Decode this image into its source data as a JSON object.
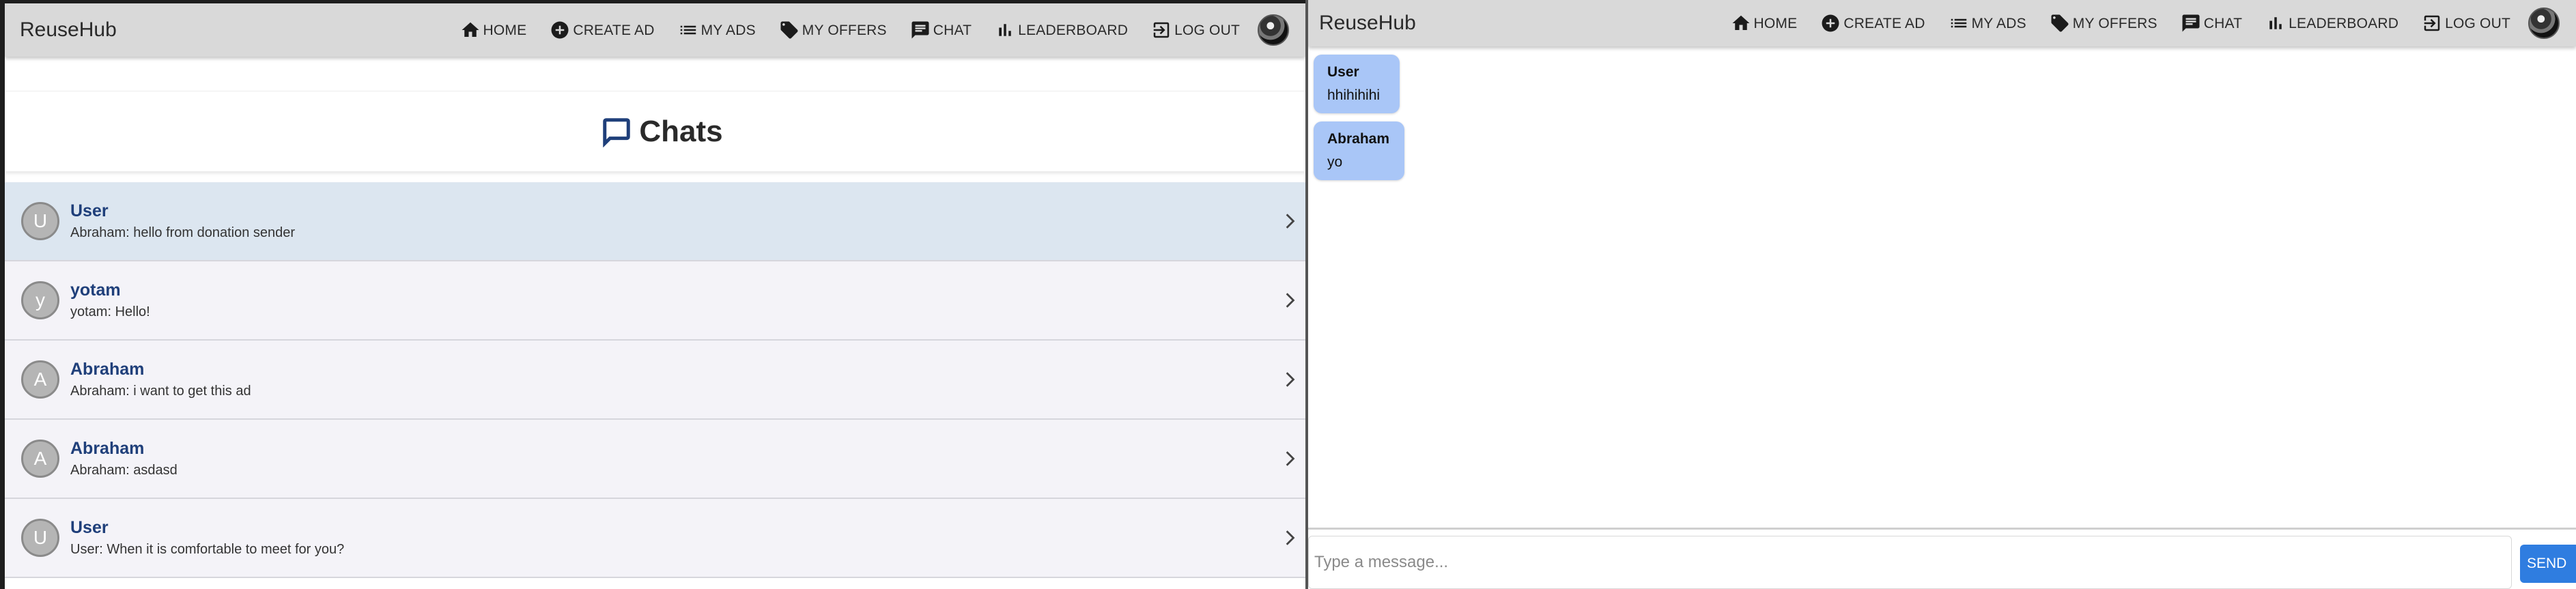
{
  "brand": "ReuseHub",
  "nav": [
    {
      "label": "HOME",
      "icon": "home-icon"
    },
    {
      "label": "CREATE AD",
      "icon": "plus-circle-icon"
    },
    {
      "label": "MY ADS",
      "icon": "list-icon"
    },
    {
      "label": "MY OFFERS",
      "icon": "tag-icon"
    },
    {
      "label": "CHAT",
      "icon": "chat-icon"
    },
    {
      "label": "LEADERBOARD",
      "icon": "bar-chart-icon"
    },
    {
      "label": "LOG OUT",
      "icon": "logout-icon"
    }
  ],
  "chats_page": {
    "title": "Chats",
    "items": [
      {
        "initial": "U",
        "name": "User",
        "preview": "Abraham: hello from donation sender",
        "active": true
      },
      {
        "initial": "y",
        "name": "yotam",
        "preview": "yotam: Hello!"
      },
      {
        "initial": "A",
        "name": "Abraham",
        "preview": "Abraham: i want to get this ad"
      },
      {
        "initial": "A",
        "name": "Abraham",
        "preview": "Abraham: asdasd"
      },
      {
        "initial": "U",
        "name": "User",
        "preview": "User: When it is comfortable to meet for you?"
      }
    ]
  },
  "chat_room": {
    "messages": [
      {
        "sender": "User",
        "text": "hhihihihi"
      },
      {
        "sender": "Abraham",
        "text": "yo"
      }
    ],
    "input_placeholder": "Type a message...",
    "send_label": "SEND"
  },
  "colors": {
    "navbar_bg": "#d9d9d9",
    "accent": "#1f3f7a",
    "message_bubble": "#a9c6f7",
    "send_button": "#2f7de0",
    "active_row": "#dce6f0"
  }
}
